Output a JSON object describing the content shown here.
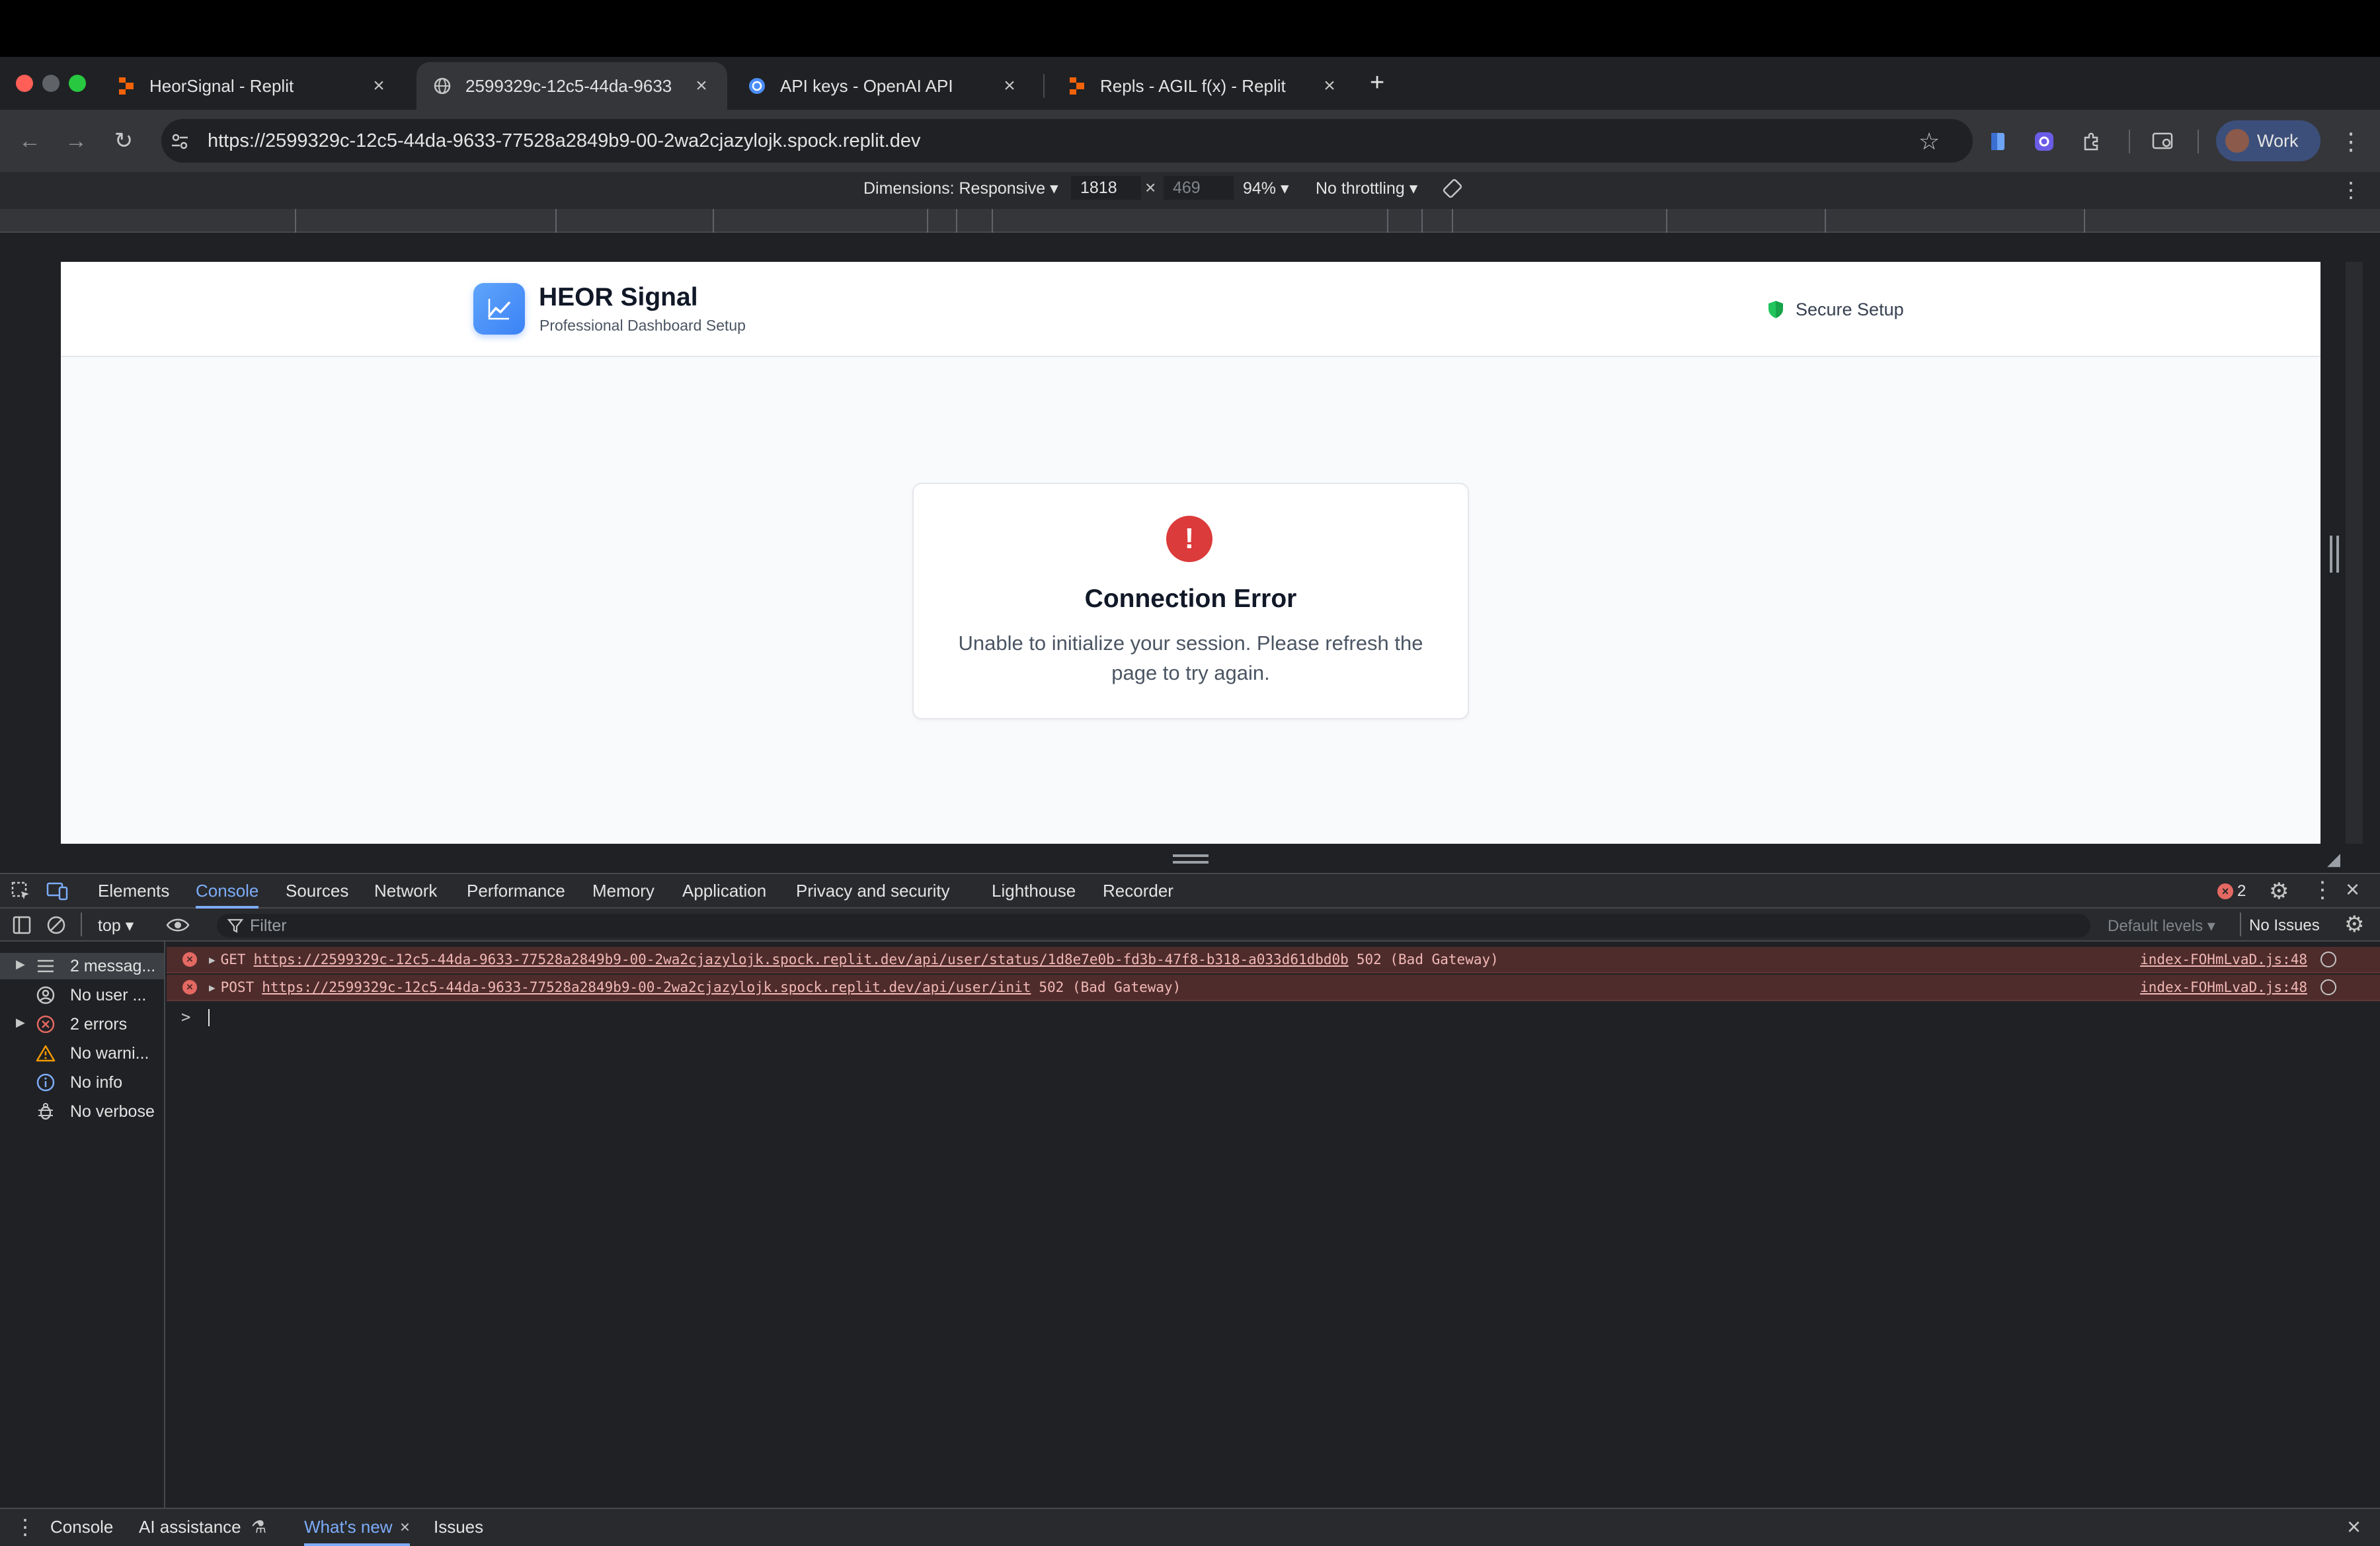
{
  "browser": {
    "tabs": [
      {
        "title": "HeorSignal - Replit",
        "active": false
      },
      {
        "title": "2599329c-12c5-44da-9633",
        "active": true
      },
      {
        "title": "API keys - OpenAI API",
        "active": false
      },
      {
        "title": "Repls - AGIL f(x) - Replit",
        "active": false
      }
    ],
    "new_tab_label": "+",
    "url": "https://2599329c-12c5-44da-9633-77528a2849b9-00-2wa2cjazylojk.spock.replit.dev",
    "profile_label": "Work"
  },
  "device_toolbar": {
    "dimensions_label": "Dimensions: Responsive",
    "width": "1818",
    "times": "×",
    "height": "469",
    "zoom": "94%",
    "throttling": "No throttling"
  },
  "app": {
    "name": "HEOR Signal",
    "subtitle": "Professional Dashboard Setup",
    "secure_label": "Secure Setup",
    "error": {
      "icon": "!",
      "title": "Connection Error",
      "message": "Unable to initialize your session. Please refresh the page to try again."
    }
  },
  "devtools": {
    "tabs": [
      "Elements",
      "Console",
      "Sources",
      "Network",
      "Performance",
      "Memory",
      "Application",
      "Privacy and security",
      "Lighthouse",
      "Recorder"
    ],
    "active_tab": "Console",
    "error_count": "2",
    "context": "top",
    "filter_placeholder": "Filter",
    "levels": "Default levels",
    "issues": "No Issues",
    "sidebar": [
      {
        "label": "2 messag...",
        "icon": "list-icon"
      },
      {
        "label": "No user ...",
        "icon": "user-icon"
      },
      {
        "label": "2 errors",
        "icon": "error-icon"
      },
      {
        "label": "No warni...",
        "icon": "warning-icon"
      },
      {
        "label": "No info",
        "icon": "info-icon"
      },
      {
        "label": "No verbose",
        "icon": "bug-icon"
      }
    ],
    "messages": [
      {
        "method": "GET",
        "url": "https://2599329c-12c5-44da-9633-77528a2849b9-00-2wa2cjazylojk.spock.replit.dev/api/user/status/1d8e7e0b-fd3b-47f8-b318-a033d61dbd0b",
        "status": "502 (Bad Gateway)",
        "source": "index-FOHmLvaD.js:48"
      },
      {
        "method": "POST",
        "url": "https://2599329c-12c5-44da-9633-77528a2849b9-00-2wa2cjazylojk.spock.replit.dev/api/user/init",
        "status": "502 (Bad Gateway)",
        "source": "index-FOHmLvaD.js:48"
      }
    ],
    "prompt": ">",
    "drawer_tabs": [
      "Console",
      "AI assistance",
      "What's new",
      "Issues"
    ]
  },
  "colors": {
    "accent": "#7cacf8",
    "error": "#dc3b3b",
    "app_logo": "#3b82f6",
    "secure": "#22c55e"
  }
}
